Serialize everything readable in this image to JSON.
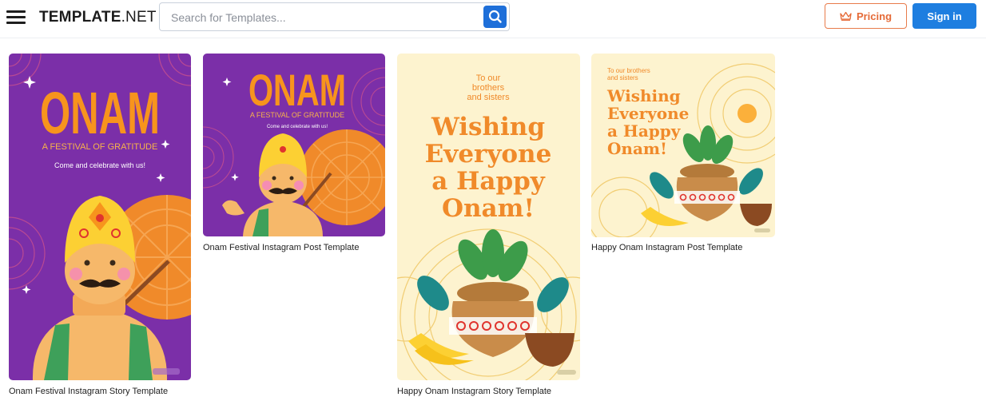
{
  "header": {
    "logo_bold": "TEMPLATE",
    "logo_suffix": ".NET",
    "search_placeholder": "Search for Templates...",
    "pricing_label": "Pricing",
    "signin_label": "Sign in"
  },
  "colors": {
    "brand_blue": "#1e7ee0",
    "pricing_orange": "#e56a37",
    "purple_bg": "#7b2fa8",
    "cream_bg": "#fdf3cf",
    "festive_orange": "#f08a2a"
  },
  "cards": [
    {
      "caption": "Onam Festival Instagram Story Template",
      "art": {
        "title": "ONAM",
        "subtitle": "A FESTIVAL OF GRATITUDE",
        "tagline": "Come and celebrate with us!"
      }
    },
    {
      "caption": "Onam Festival Instagram Post Template",
      "art": {
        "title": "ONAM",
        "subtitle": "A FESTIVAL OF GRATITUDE",
        "tagline": "Come and celebrate with us!"
      }
    },
    {
      "caption": "Happy Onam Instagram Story Template",
      "art": {
        "intro_line1": "To our",
        "intro_line2": "brothers",
        "intro_line3": "and sisters",
        "wish_line1": "Wishing",
        "wish_line2": "Everyone",
        "wish_line3": "a Happy",
        "wish_line4": "Onam!"
      }
    },
    {
      "caption": "Happy Onam Instagram Post Template",
      "art": {
        "intro_line1": "To our brothers",
        "intro_line2": "and sisters",
        "wish_line1": "Wishing",
        "wish_line2": "Everyone",
        "wish_line3": "a Happy",
        "wish_line4": "Onam!"
      }
    }
  ],
  "icons": [
    "menu-icon",
    "search-icon",
    "crown-icon"
  ]
}
